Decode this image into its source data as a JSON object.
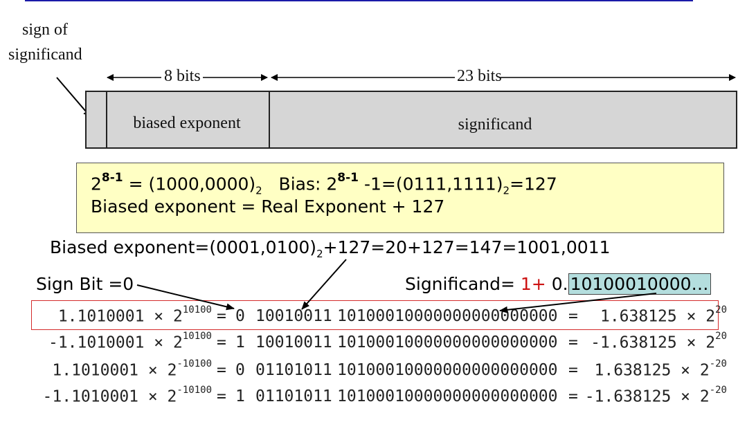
{
  "header": {
    "rule_color": "#1a1aa8"
  },
  "diagram": {
    "sign_label_line1": "sign of",
    "sign_label_line2": "significand",
    "exponent_width": "8 bits",
    "significand_width": "23 bits",
    "field_exponent": "biased exponent",
    "field_significand": "significand",
    "field_fill_color": "#d6d6d6"
  },
  "formula_box": {
    "line1": {
      "base1": "2",
      "exp1": "8-1",
      "eq1": " = (1000,0000)",
      "sub1": "2",
      "bias_text": "   Bias: 2",
      "exp2": "8-1",
      "rest": " -1=(0111,1111)",
      "sub2": "2",
      "tail": "=127"
    },
    "line2": "Biased exponent = Real Exponent + 127",
    "background": "#ffffc4"
  },
  "biased_calc": {
    "prefix": "Biased exponent=(0001,0100)",
    "sub": "2",
    "suffix": "+127=20+127=147=1001,0011"
  },
  "sign_bit_label": "Sign Bit =0",
  "significand_label": {
    "prefix": "Significand= ",
    "one": "1+",
    "mid": " 0.",
    "fraction": "10100010000…",
    "one_color": "#cc1111",
    "fraction_bg": "#b4dede"
  },
  "examples": [
    {
      "left": "1.1010001 × 2",
      "left_exp": "10100",
      "eq1": "=",
      "sign": "0",
      "exponent": "10010011",
      "fraction": "10100010000000000000000",
      "eq2": "=",
      "right": "1.638125 × 2",
      "right_exp": "20"
    },
    {
      "left": "-1.1010001 × 2",
      "left_exp": "10100",
      "eq1": "=",
      "sign": "1",
      "exponent": "10010011",
      "fraction": "10100010000000000000000",
      "eq2": "=",
      "right": "-1.638125 × 2",
      "right_exp": "20"
    },
    {
      "left": "1.1010001 × 2",
      "left_exp": "-10100",
      "eq1": "=",
      "sign": "0",
      "exponent": "01101011",
      "fraction": "10100010000000000000000",
      "eq2": "=",
      "right": "1.638125 × 2",
      "right_exp": "-20"
    },
    {
      "left": "-1.1010001 × 2",
      "left_exp": "-10100",
      "eq1": "=",
      "sign": "1",
      "exponent": "01101011",
      "fraction": "10100010000000000000000",
      "eq2": "=",
      "right": "-1.638125 × 2",
      "right_exp": "-20"
    }
  ],
  "highlight_color": "#d42a2a"
}
